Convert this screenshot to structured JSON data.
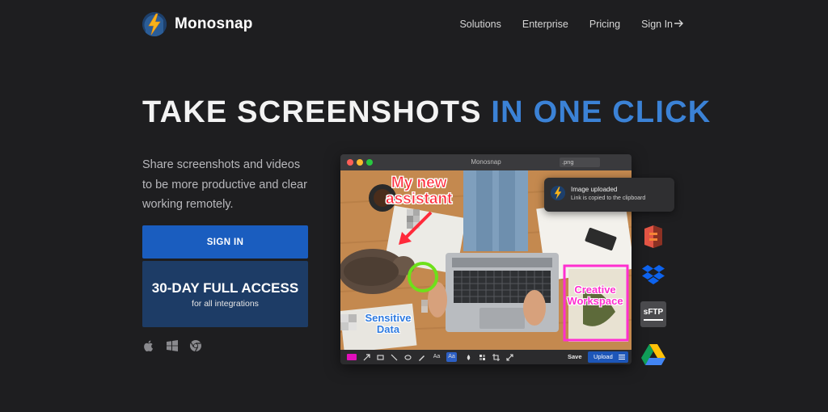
{
  "brand": {
    "name": "Monosnap",
    "logo_icon": "lightning-bolt-icon",
    "accent": "#3b82d6"
  },
  "nav": {
    "items": [
      {
        "label": "Solutions"
      },
      {
        "label": "Enterprise"
      },
      {
        "label": "Pricing"
      },
      {
        "label": "Sign In"
      }
    ],
    "sign_in_icon": "arrow-right-icon"
  },
  "hero": {
    "title_white": "TAKE SCREENSHOTS",
    "title_blue": "IN ONE CLICK",
    "subtitle": "Share screenshots and videos to be more productive and clear working remotely."
  },
  "cta": {
    "sign_in": "SIGN IN",
    "trial_title": "30-DAY FULL ACCESS",
    "trial_subtitle": "for all integrations",
    "primary_color": "#1a5dbf",
    "secondary_color": "#1d3c66"
  },
  "platforms": [
    "apple-icon",
    "windows-icon",
    "chrome-icon"
  ],
  "app_window": {
    "title": "Monosnap",
    "extension": ".png",
    "annotations": {
      "red": [
        "My new",
        "assistant"
      ],
      "pink": [
        "Creative",
        "Workspace"
      ],
      "blue": [
        "Sensitive",
        "Data"
      ]
    },
    "toolbar": {
      "text_tool": "Aa",
      "text_tool_active": "Aa",
      "save": "Save",
      "upload": "Upload"
    }
  },
  "notification": {
    "title": "Image uploaded",
    "message": "Link is copied to the clipboard"
  },
  "integrations": [
    "amazon-s3-icon",
    "dropbox-icon",
    "sftp-icon",
    "google-drive-icon"
  ],
  "sftp_label": "sFTP"
}
